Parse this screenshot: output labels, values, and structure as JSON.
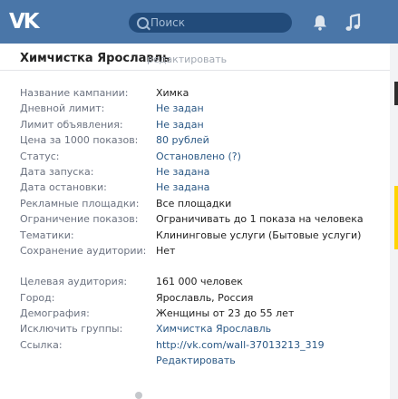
{
  "header": {
    "logo": "VK",
    "search_placeholder": "Поиск"
  },
  "card": {
    "title": "Химчистка Ярославль",
    "edit": "редактировать"
  },
  "rows": [
    {
      "label": "Название кампании:",
      "value": "Химка"
    },
    {
      "label": "Дневной лимит:",
      "value": "Не задан"
    },
    {
      "label": "Лимит объявления:",
      "value": "Не задан"
    },
    {
      "label": "Цена за 1000 показов:",
      "value": "80 рублей"
    },
    {
      "label": "Статус:",
      "value": "Остановлено",
      "extra": "(?)"
    },
    {
      "label": "Дата запуска:",
      "value": "Не задана"
    },
    {
      "label": "Дата остановки:",
      "value": "Не задана"
    },
    {
      "label": "Рекламные площадки:",
      "value": "Все площадки"
    },
    {
      "label": "Ограничение показов:",
      "value": "Ограничивать до 1 показа на человека"
    },
    {
      "label": "Тематики:",
      "value": "Клининговые услуги (Бытовые услуги)"
    },
    {
      "label": "Сохранение аудитории:",
      "value": "Нет"
    },
    {
      "label": "Целевая аудитория:",
      "value": "161 000 человек"
    },
    {
      "label": "Город:",
      "value": "Ярославль, Россия"
    },
    {
      "label": "Демография:",
      "value": "Женщины от 23 до 55 лет"
    },
    {
      "label": "Исключить группы:",
      "value": "Химчистка Ярославль"
    },
    {
      "label": "Ссылка:",
      "value": "http://vk.com/wall-37013213_319"
    }
  ],
  "bottom_edit": "Редактировать"
}
